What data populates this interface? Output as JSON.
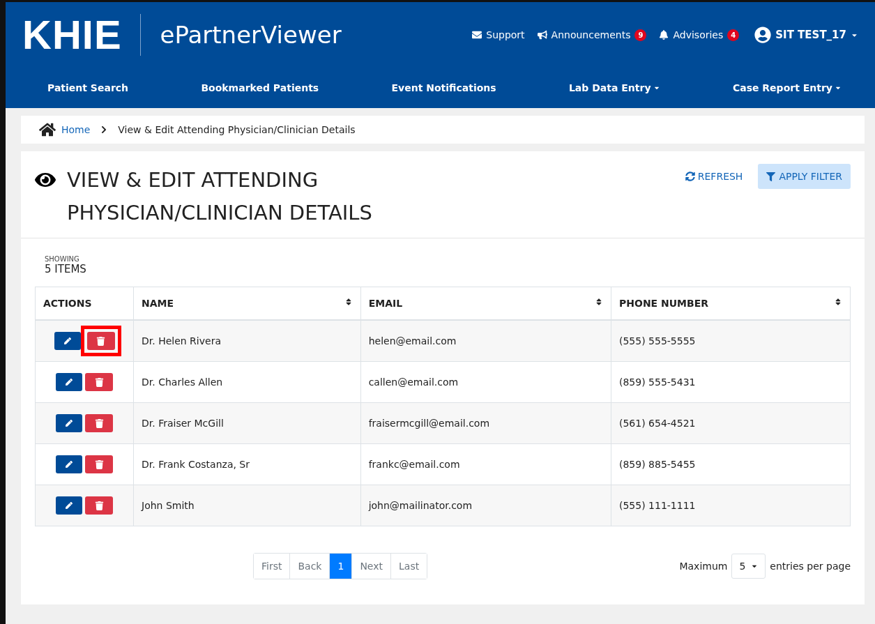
{
  "header": {
    "logo": "KHIE",
    "app_name": "ePartnerViewer",
    "links": [
      {
        "kind": "mail",
        "label": "Support"
      },
      {
        "kind": "megaphone",
        "label": "Announcements",
        "badge": "9"
      },
      {
        "kind": "bell",
        "label": "Advisories",
        "badge": "4"
      },
      {
        "kind": "user",
        "label": "SIT TEST_17",
        "dropdown": true
      }
    ]
  },
  "nav": [
    {
      "label": "Patient Search",
      "dropdown": false
    },
    {
      "label": "Bookmarked Patients",
      "dropdown": false
    },
    {
      "label": "Event Notifications",
      "dropdown": false
    },
    {
      "label": "Lab Data Entry",
      "dropdown": true
    },
    {
      "label": "Case Report Entry",
      "dropdown": true
    }
  ],
  "breadcrumb": {
    "home": "Home",
    "current": "View & Edit Attending Physician/Clinician Details"
  },
  "page": {
    "title_lines": [
      "VIEW & EDIT ATTENDING",
      "PHYSICIAN/CLINICIAN DETAILS"
    ],
    "refresh": "REFRESH",
    "apply_filter": "APPLY FILTER"
  },
  "showing": {
    "label": "SHOWING",
    "count": "5 ITEMS"
  },
  "table": {
    "columns": [
      {
        "label": "ACTIONS",
        "sortable": false
      },
      {
        "label": "NAME",
        "sortable": true
      },
      {
        "label": "EMAIL",
        "sortable": true
      },
      {
        "label": "PHONE NUMBER",
        "sortable": true
      }
    ],
    "rows": [
      {
        "name": "Dr. Helen Rivera",
        "email": "helen@email.com",
        "phone": "(555) 555-5555",
        "delete_highlighted": true
      },
      {
        "name": "Dr. Charles Allen",
        "email": "callen@email.com",
        "phone": "(859) 555-5431",
        "delete_highlighted": false
      },
      {
        "name": "Dr. Fraiser McGill",
        "email": "fraisermcgill@email.com",
        "phone": "(561) 654-4521",
        "delete_highlighted": false
      },
      {
        "name": "Dr. Frank Costanza, Sr",
        "email": "frankc@email.com",
        "phone": "(859) 885-5455",
        "delete_highlighted": false
      },
      {
        "name": "John Smith",
        "email": "john@mailinator.com",
        "phone": "(555) 111-1111",
        "delete_highlighted": false
      }
    ]
  },
  "pagination": [
    {
      "label": "First",
      "selected": false
    },
    {
      "label": "Back",
      "selected": false
    },
    {
      "label": "1",
      "selected": true
    },
    {
      "label": "Next",
      "selected": false
    },
    {
      "label": "Last",
      "selected": false
    }
  ],
  "page_size": {
    "prefix": "Maximum",
    "value": "5",
    "suffix": "entries per page"
  }
}
